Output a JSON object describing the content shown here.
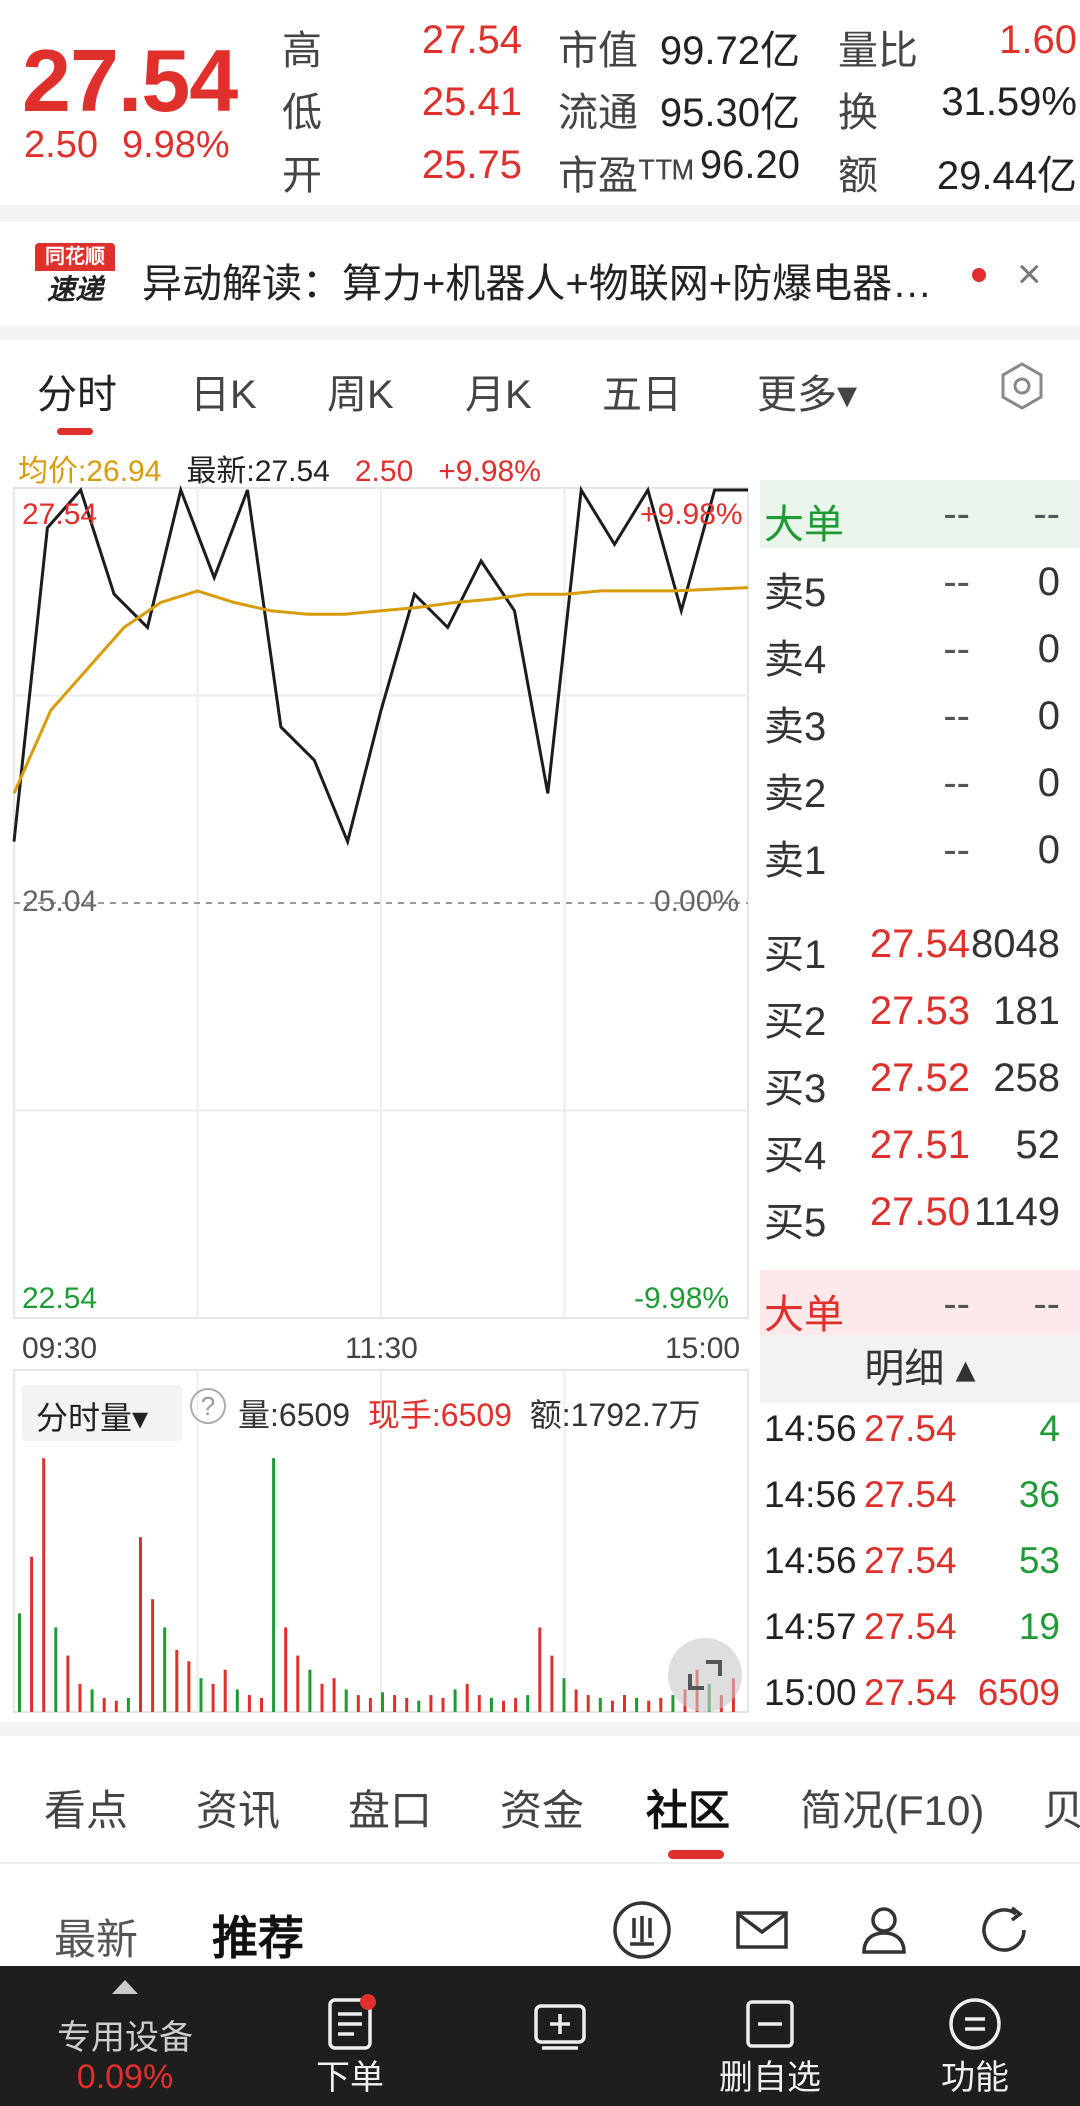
{
  "quote": {
    "price": "27.54",
    "change": "2.50",
    "change_pct": "9.98%",
    "rows": [
      {
        "label": "高",
        "value": "27.54",
        "label2": "市值",
        "value2": "99.72亿",
        "label3": "量比",
        "value3": "1.60"
      },
      {
        "label": "低",
        "value": "25.41",
        "label2": "流通",
        "value2": "95.30亿",
        "label3": "换",
        "value3": "31.59%"
      },
      {
        "label": "开",
        "value": "25.75",
        "label2": "市盈ᵀᵀᴹ",
        "value2": "96.20",
        "label3": "额",
        "value3": "29.44亿"
      }
    ]
  },
  "news": {
    "logo_top": "同花顺",
    "logo_bottom": "速递",
    "text": "异动解读：算力+机器人+物联网+防爆电器…",
    "close": "×"
  },
  "ktabs": [
    "分时",
    "日K",
    "周K",
    "月K",
    "五日",
    "更多▾"
  ],
  "infoline": {
    "avg": "均价:26.94",
    "latest": "最新:27.54",
    "chg": "2.50",
    "pct": "+9.98%"
  },
  "chart_data": {
    "type": "line",
    "x": [
      "09:30",
      "11:30",
      "15:00"
    ],
    "ylim": [
      22.54,
      27.54
    ],
    "y_left_labels": [
      "27.54",
      "25.04",
      "22.54"
    ],
    "y_right_labels": [
      "+9.98%",
      "0.00%",
      "-9.98%"
    ],
    "series": [
      {
        "values": [
          25.41,
          27.3,
          27.54,
          26.9,
          26.7,
          27.54,
          27.0,
          27.54,
          26.1,
          25.9,
          25.41,
          26.2,
          26.9,
          26.7,
          27.1,
          26.8,
          25.7,
          27.54,
          27.2,
          27.54,
          26.8,
          27.54,
          27.54
        ]
      },
      {
        "values": [
          25.7,
          26.2,
          26.45,
          26.7,
          26.85,
          26.92,
          26.85,
          26.8,
          26.78,
          26.78,
          26.8,
          26.82,
          26.85,
          26.87,
          26.9,
          26.9,
          26.92,
          26.92,
          26.92,
          26.93,
          26.94
        ]
      }
    ]
  },
  "volume": {
    "selector": "分时量▾",
    "help": "?",
    "vol": "量:6509",
    "now": "现手:6509",
    "amt": "额:1792.7万"
  },
  "book": {
    "big_label": "大单",
    "dash": "--",
    "sells": [
      {
        "label": "卖5",
        "price": "--",
        "vol": "0"
      },
      {
        "label": "卖4",
        "price": "--",
        "vol": "0"
      },
      {
        "label": "卖3",
        "price": "--",
        "vol": "0"
      },
      {
        "label": "卖2",
        "price": "--",
        "vol": "0"
      },
      {
        "label": "卖1",
        "price": "--",
        "vol": "0"
      }
    ],
    "buys": [
      {
        "label": "买1",
        "price": "27.54",
        "vol": "8048"
      },
      {
        "label": "买2",
        "price": "27.53",
        "vol": "181"
      },
      {
        "label": "买3",
        "price": "27.52",
        "vol": "258"
      },
      {
        "label": "买4",
        "price": "27.51",
        "vol": "52"
      },
      {
        "label": "买5",
        "price": "27.50",
        "vol": "1149"
      }
    ],
    "detail_head": "明细 ▴",
    "details": [
      {
        "t": "14:56",
        "p": "27.54",
        "v": "4",
        "color": "green"
      },
      {
        "t": "14:56",
        "p": "27.54",
        "v": "36",
        "color": "green"
      },
      {
        "t": "14:56",
        "p": "27.54",
        "v": "53",
        "color": "green"
      },
      {
        "t": "14:57",
        "p": "27.54",
        "v": "19",
        "color": "green"
      },
      {
        "t": "15:00",
        "p": "27.54",
        "v": "6509",
        "color": "red"
      }
    ]
  },
  "subtabs": [
    "看点",
    "资讯",
    "盘口",
    "资金",
    "社区",
    "简况(F10)",
    "贝"
  ],
  "feed": {
    "latest": "最新",
    "recommended": "推荐"
  },
  "bottomnav": {
    "device": "专用设备",
    "device_pct": "0.09%",
    "order": "下单",
    "remove": "删自选",
    "func": "功能"
  }
}
